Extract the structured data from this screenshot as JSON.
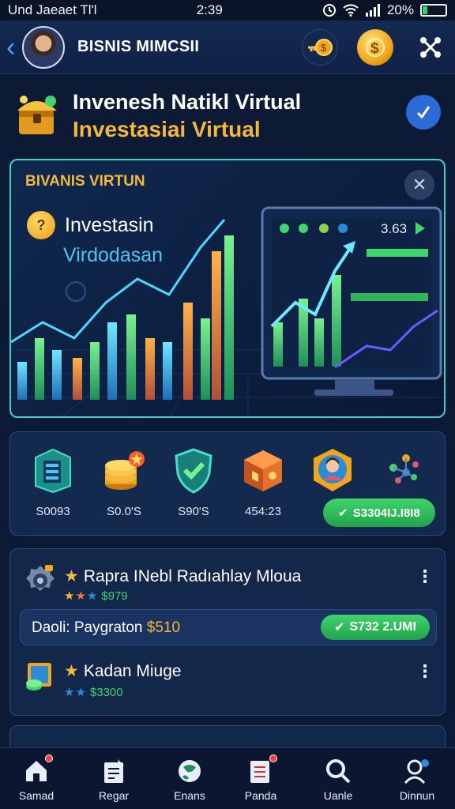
{
  "status_bar": {
    "carrier": "Und Jaeaet  Tl'l",
    "time": "2:39",
    "battery": "20%",
    "battery_level": 0.2
  },
  "header": {
    "title": "BISNIS MIMCSII"
  },
  "title_section": {
    "line1": "Invenesh Natikl Virtual",
    "line2": "Investasiai Virtual"
  },
  "hero": {
    "tag": "BIVANIS VIRTUN",
    "line1": "Investasin",
    "line2": "Virdodasan",
    "badge": "?",
    "monitor_value": "3.63"
  },
  "assets": {
    "items": [
      {
        "icon": "server-icon",
        "value": "S0093"
      },
      {
        "icon": "coin-stack-icon",
        "value": "S0.0'S"
      },
      {
        "icon": "shield-check-icon",
        "value": "S90'S"
      },
      {
        "icon": "cube-icon",
        "value": "454:23"
      },
      {
        "icon": "avatar-badge-icon",
        "value": ""
      },
      {
        "icon": "molecule-icon",
        "value": ""
      }
    ],
    "pill_label": "S3304IJ.I8I8"
  },
  "list": {
    "item1": {
      "title": "Rapra INebl Radıahlay Mloua",
      "sub": "$979"
    },
    "payment": {
      "label": "Daoli: Paygraton",
      "amount": "$510",
      "pill": "S732 2.UMI"
    },
    "item2": {
      "title": "Kadan Miuge",
      "sub": "$3300"
    }
  },
  "nav": [
    {
      "label": "Samad",
      "icon": "home-icon"
    },
    {
      "label": "Regar",
      "icon": "clipboard-icon"
    },
    {
      "label": "Enans",
      "icon": "globe-icon"
    },
    {
      "label": "Panda",
      "icon": "document-icon"
    },
    {
      "label": "Uanle",
      "icon": "search-icon"
    },
    {
      "label": "Dinnun",
      "icon": "user-settings-icon"
    }
  ],
  "colors": {
    "accent": "#f5b83a",
    "teal": "#3fd2c9",
    "green": "#3fd56e",
    "bg": "#0c1a35"
  }
}
